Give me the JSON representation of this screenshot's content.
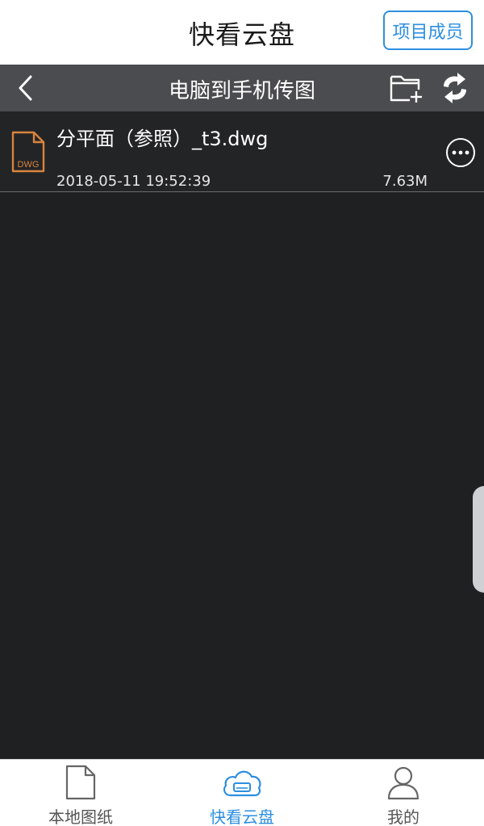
{
  "header": {
    "title": "快看云盘",
    "members_button": "项目成员"
  },
  "nav": {
    "title": "电脑到手机传图",
    "back_icon": "chevron-left-icon",
    "new_folder_icon": "new-folder-icon",
    "sync_icon": "sync-icon"
  },
  "files": [
    {
      "name": "分平面（参照）_t3.dwg",
      "date": "2018-05-11 19:52:39",
      "size": "7.63M",
      "type_label": "DWG",
      "icon_color": "#d9843e"
    }
  ],
  "tabs": [
    {
      "label": "本地图纸",
      "icon": "document-icon",
      "active": false
    },
    {
      "label": "快看云盘",
      "icon": "cloud-drive-icon",
      "active": true
    },
    {
      "label": "我的",
      "icon": "user-icon",
      "active": false
    }
  ],
  "colors": {
    "accent": "#2d8fe0",
    "background": "#1f2022",
    "nav_bar": "#4b4c4f"
  }
}
